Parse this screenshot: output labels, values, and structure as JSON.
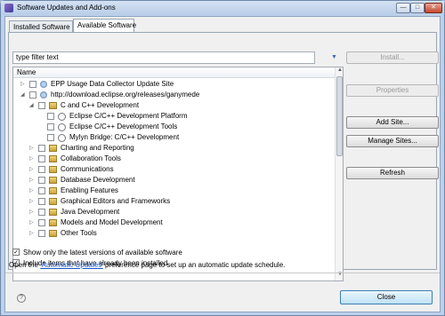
{
  "window": {
    "title": "Software Updates and Add-ons",
    "controls": [
      "minimize-icon",
      "maximize-icon",
      "close-icon"
    ]
  },
  "tabs": [
    {
      "label": "Installed Software"
    },
    {
      "label": "Available Software"
    }
  ],
  "filter": {
    "value": "type filter text"
  },
  "tree": {
    "header": "Name",
    "rows": [
      {
        "label": "EPP Usage Data Collector Update Site",
        "icon": "site-icon",
        "expander": "▷"
      },
      {
        "label": "http://download.eclipse.org/releases/ganymede",
        "icon": "site-icon",
        "expander": "◢"
      },
      {
        "label": "C and C++ Development",
        "icon": "category-icon",
        "expander": "◢"
      },
      {
        "label": "Eclipse C/C++ Development Platform",
        "icon": "plugin-icon",
        "expander": ""
      },
      {
        "label": "Eclipse C/C++ Development Tools",
        "icon": "plugin-icon",
        "expander": ""
      },
      {
        "label": "Mylyn Bridge: C/C++ Development",
        "icon": "plugin-icon",
        "expander": ""
      },
      {
        "label": "Charting and Reporting",
        "icon": "category-icon",
        "expander": "▷"
      },
      {
        "label": "Collaboration Tools",
        "icon": "category-icon",
        "expander": "▷"
      },
      {
        "label": "Communications",
        "icon": "category-icon",
        "expander": "▷"
      },
      {
        "label": "Database Development",
        "icon": "category-icon",
        "expander": "▷"
      },
      {
        "label": "Enabling Features",
        "icon": "category-icon",
        "expander": "▷"
      },
      {
        "label": "Graphical Editors and Frameworks",
        "icon": "category-icon",
        "expander": "▷"
      },
      {
        "label": "Java Development",
        "icon": "category-icon",
        "expander": "▷"
      },
      {
        "label": "Models and Model Development",
        "icon": "category-icon",
        "expander": "▷"
      },
      {
        "label": "Other Tools",
        "icon": "category-icon",
        "expander": "▷"
      }
    ]
  },
  "buttons": {
    "install": "Install...",
    "properties": "Properties",
    "add_site": "Add Site...",
    "manage_sites": "Manage Sites...",
    "refresh": "Refresh"
  },
  "options": [
    {
      "label": "Show only the latest versions of available software",
      "checked": true
    },
    {
      "label": "Include items that have already been installed",
      "checked": true
    }
  ],
  "note": {
    "prefix": "Open the ",
    "link": "'Automatic Updates'",
    "suffix": " preference page to set up an automatic update schedule."
  },
  "footer": {
    "close": "Close",
    "help_icon": "help-icon"
  }
}
